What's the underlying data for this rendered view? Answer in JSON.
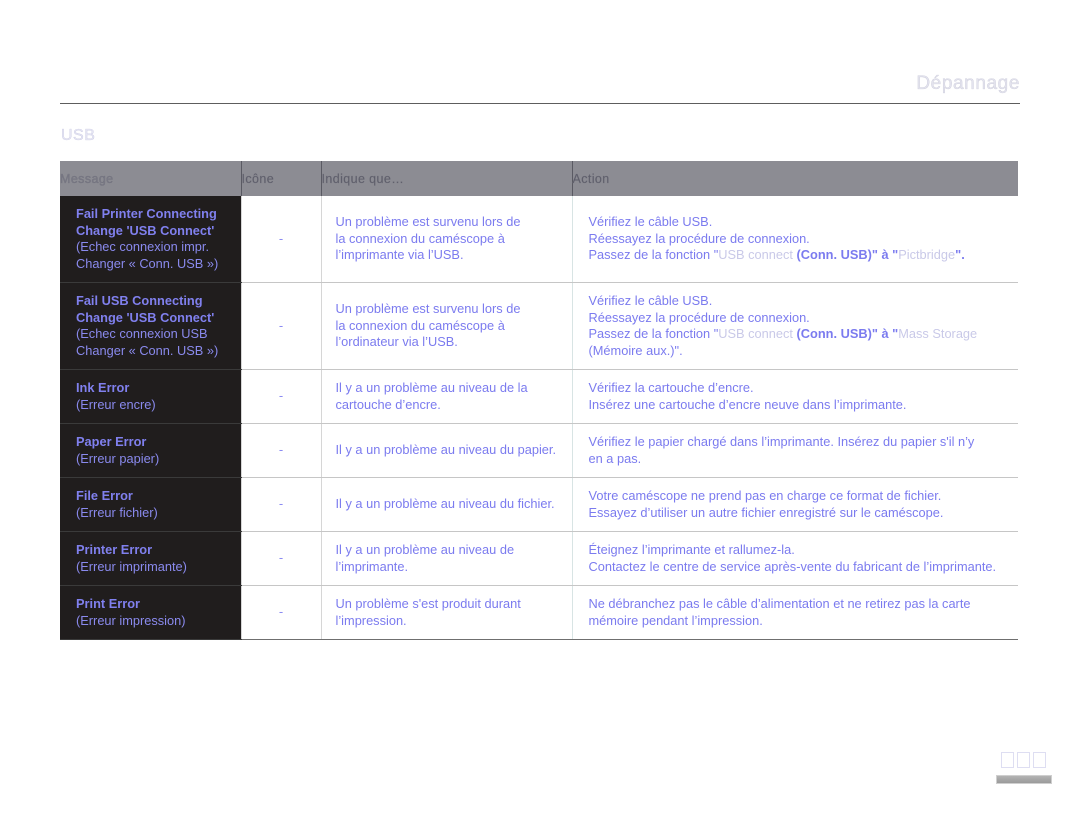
{
  "header": {
    "running_head": "Dépannage",
    "section_title": "USB"
  },
  "table": {
    "columns": [
      {
        "key": "message",
        "label": "Message"
      },
      {
        "key": "icon",
        "label": "Icône"
      },
      {
        "key": "means",
        "label": "Indique que…"
      },
      {
        "key": "action",
        "label": "Action"
      }
    ],
    "rows": [
      {
        "message_native_lines": [
          "Fail Printer Connecting",
          "Change 'USB Connect'"
        ],
        "message_translated_lines": [
          "(Echec connexion impr.",
          "Changer « Conn. USB »)"
        ],
        "icon": "-",
        "means_lines": [
          "Un problème est survenu lors de",
          "la connexion du caméscope à",
          "l’imprimante via l’USB."
        ],
        "action_lines": [
          "Vérifiez le câble USB.",
          "Réessayez la procédure de connexion."
        ],
        "action_rich": {
          "prefix": "Passez de la fonction \"",
          "dim1": "USB connect",
          "mid": " (Conn. USB)\" à \"",
          "dim2": "Pictbridge",
          "suffix": "\"."
        }
      },
      {
        "message_native_lines": [
          "Fail USB Connecting",
          "Change 'USB Connect'"
        ],
        "message_translated_lines": [
          "(Echec connexion USB",
          "Changer « Conn. USB »)"
        ],
        "icon": "-",
        "means_lines": [
          "Un problème est survenu lors de",
          "la connexion du caméscope à",
          "l’ordinateur via l’USB."
        ],
        "action_lines": [
          "Vérifiez le câble USB.",
          "Réessayez la procédure de connexion."
        ],
        "action_rich": {
          "prefix": "Passez de la fonction \"",
          "dim1": "USB connect",
          "mid": " (Conn. USB)\" à \"",
          "dim2": "Mass Storage",
          "suffix": "",
          "tail": "(Mémoire aux.)\"."
        }
      },
      {
        "message_native_lines": [
          "Ink Error"
        ],
        "message_translated_lines": [
          "(Erreur encre)"
        ],
        "icon": "-",
        "means_lines": [
          "Il y a un problème au niveau de la",
          "cartouche d’encre."
        ],
        "action_lines": [
          "Vérifiez la cartouche d’encre.",
          "Insérez une cartouche d’encre neuve dans l’imprimante."
        ]
      },
      {
        "message_native_lines": [
          "Paper Error"
        ],
        "message_translated_lines": [
          "(Erreur papier)"
        ],
        "icon": "-",
        "means_lines": [
          "Il y a un problème au niveau du papier."
        ],
        "action_lines": [
          "Vérifiez le papier chargé dans l’imprimante. Insérez du papier s'il n’y",
          "en a pas."
        ]
      },
      {
        "message_native_lines": [
          "File Error"
        ],
        "message_translated_lines": [
          "(Erreur fichier)"
        ],
        "icon": "-",
        "means_lines": [
          "Il y a un problème au niveau du fichier."
        ],
        "action_lines": [
          "Votre caméscope ne prend pas en charge ce format de fichier.",
          "Essayez d’utiliser un autre fichier enregistré sur le caméscope."
        ]
      },
      {
        "message_native_lines": [
          "Printer Error"
        ],
        "message_translated_lines": [
          "(Erreur imprimante)"
        ],
        "icon": "-",
        "means_lines": [
          "Il y a un problème au niveau de",
          "l’imprimante."
        ],
        "action_lines": [
          "Éteignez l’imprimante et rallumez-la.",
          "Contactez le centre de service après-vente du fabricant de l’imprimante."
        ]
      },
      {
        "message_native_lines": [
          "Print Error"
        ],
        "message_translated_lines": [
          "(Erreur impression)"
        ],
        "icon": "-",
        "means_lines": [
          "Un problème s'est produit durant",
          "l’impression."
        ],
        "action_lines": [
          "Ne débranchez pas le câble d’alimentation et ne retirez pas la carte",
          "mémoire pendant l’impression."
        ]
      }
    ]
  },
  "footer": {
    "page_number_placeholder": [
      "",
      "",
      ""
    ]
  },
  "colors": {
    "accent_text": "#7b7bef",
    "message_bg": "#201d1d",
    "header_bg": "#8c8c93",
    "dim_text": "#c9c9e8"
  }
}
